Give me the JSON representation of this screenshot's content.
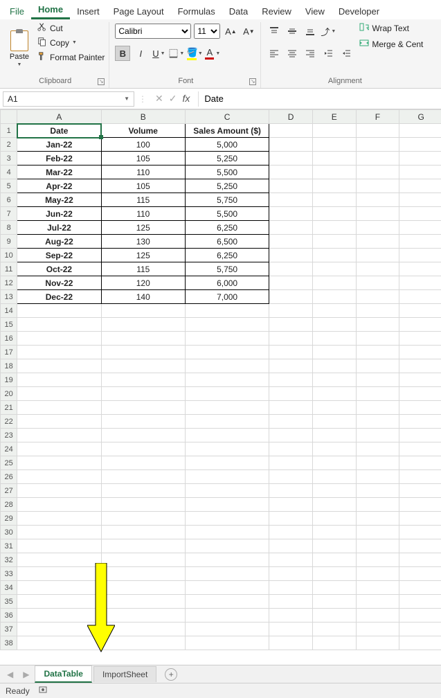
{
  "menu": {
    "tabs": [
      "File",
      "Home",
      "Insert",
      "Page Layout",
      "Formulas",
      "Data",
      "Review",
      "View",
      "Developer"
    ],
    "active": "Home"
  },
  "ribbon": {
    "clipboard": {
      "label": "Clipboard",
      "paste": "Paste",
      "cut": "Cut",
      "copy": "Copy",
      "format_painter": "Format Painter"
    },
    "font": {
      "label": "Font",
      "name": "Calibri",
      "size": "11",
      "bold_active": true
    },
    "alignment": {
      "label": "Alignment",
      "wrap": "Wrap Text",
      "merge": "Merge & Cent"
    }
  },
  "name_box": "A1",
  "formula_value": "Date",
  "columns": [
    "A",
    "B",
    "C",
    "D",
    "E",
    "F",
    "G"
  ],
  "chart_data": {
    "type": "table",
    "headers": [
      "Date",
      "Volume",
      "Sales Amount ($)"
    ],
    "rows": [
      [
        "Jan-22",
        "100",
        "5,000"
      ],
      [
        "Feb-22",
        "105",
        "5,250"
      ],
      [
        "Mar-22",
        "110",
        "5,500"
      ],
      [
        "Apr-22",
        "105",
        "5,250"
      ],
      [
        "May-22",
        "115",
        "5,750"
      ],
      [
        "Jun-22",
        "110",
        "5,500"
      ],
      [
        "Jul-22",
        "125",
        "6,250"
      ],
      [
        "Aug-22",
        "130",
        "6,500"
      ],
      [
        "Sep-22",
        "125",
        "6,250"
      ],
      [
        "Oct-22",
        "115",
        "5,750"
      ],
      [
        "Nov-22",
        "120",
        "6,000"
      ],
      [
        "Dec-22",
        "140",
        "7,000"
      ]
    ]
  },
  "total_rows": 38,
  "sheets": {
    "tabs": [
      "DataTable",
      "ImportSheet"
    ],
    "active": "DataTable"
  },
  "status": {
    "ready": "Ready"
  }
}
